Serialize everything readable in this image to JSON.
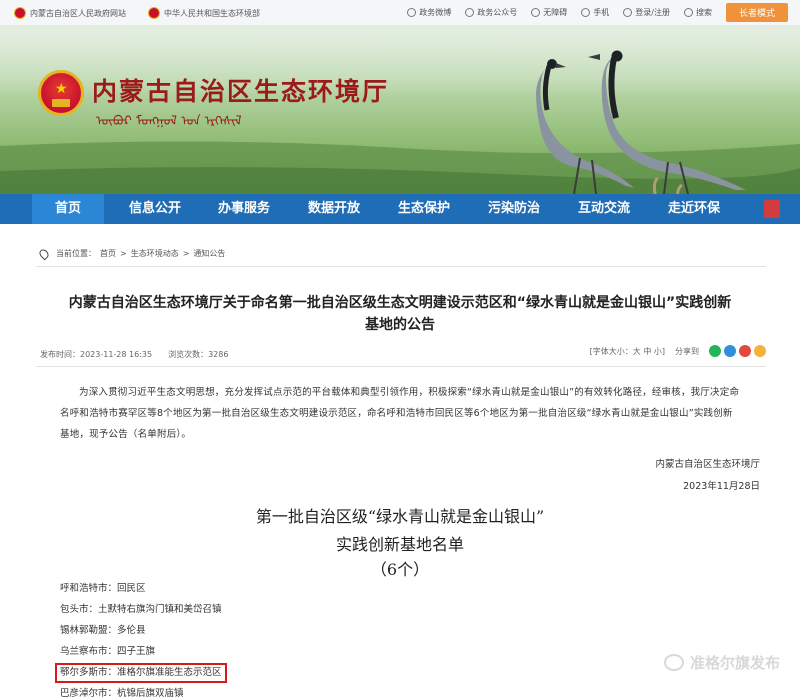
{
  "topbar": {
    "link1": "内蒙古自治区人民政府网站",
    "link2": "中华人民共和国生态环境部",
    "tools": [
      "政务微博",
      "政务公众号",
      "无障碍",
      "手机",
      "登录/注册",
      "搜索"
    ],
    "care_mode": "长者模式"
  },
  "banner": {
    "title": "内蒙古自治区生态环境厅",
    "mongolian": "ᠥᠪᠥᠷ ᠮᠣᠩᠭᠣᠯ ᠤᠨ ᠡᠷᠬᠡᠰᠢᠯ"
  },
  "nav": {
    "items": [
      "首页",
      "信息公开",
      "办事服务",
      "数据开放",
      "生态保护",
      "污染防治",
      "互动交流",
      "走近环保"
    ]
  },
  "breadcrumb": {
    "label": "当前位置：",
    "items": [
      "首页",
      "生态环境动态",
      "通知公告"
    ]
  },
  "article": {
    "title_line1": "内蒙古自治区生态环境厅关于命名第一批自治区级生态文明建设示范区和“绿水青山就是金山银山”实践创新",
    "title_line2": "基地的公告",
    "publish_time": "发布时间：2023-11-28 16:35",
    "views": "浏览次数：3286",
    "font_size": "[字体大小：大 中 小]",
    "share": "分享到",
    "paragraph": "为深入贯彻习近平生态文明思想，充分发挥试点示范的平台载体和典型引领作用，积极探索“绿水青山就是金山银山”的有效转化路径，经审核，我厅决定命名呼和浩特市赛罕区等8个地区为第一批自治区级生态文明建设示范区，命名呼和浩特市回民区等6个地区为第一批自治区级“绿水青山就是金山银山”实践创新基地，现予公告（名单附后）。",
    "sign_org": "内蒙古自治区生态环境厅",
    "sign_date": "2023年11月28日"
  },
  "list": {
    "title1": "第一批自治区级“绿水青山就是金山银山”",
    "title2": "实践创新基地名单",
    "count": "（6个）",
    "items": [
      "呼和浩特市：回民区",
      "包头市：土默特右旗沟门镇和美岱召镇",
      "锡林郭勒盟：多伦县",
      "乌兰察布市：四子王旗",
      "鄂尔多斯市：准格尔旗准能生态示范区",
      "巴彦淖尔市：杭锦后旗双庙镇"
    ]
  },
  "watermark": "准格尔旗发布",
  "colors": {
    "nav_bg": "#1f6db6",
    "nav_active": "#2c86d6",
    "title_red": "#9b1b1b",
    "highlight_border": "#d21c1c",
    "care_btn": "#f0923a"
  }
}
